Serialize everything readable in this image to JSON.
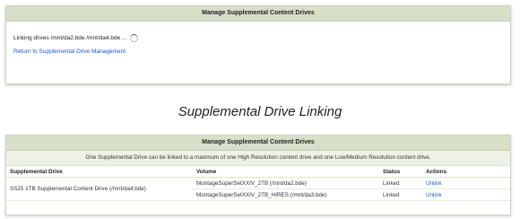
{
  "top_panel": {
    "header": "Manage Supplemental Content Drives",
    "status_text": "Linking drives /mnt/da2.bde /mnt/da4.bde ...",
    "return_link": "Return to Supplemental Drive Management",
    "spinner_icon": "spinner-icon"
  },
  "caption": "Supplemental Drive Linking",
  "bottom_panel": {
    "header": "Manage Supplemental Content Drives",
    "note": "One Supplemental Drive can be linked to a maximum of one High Resolution content drive and one Low/Medium Resolution content drive.",
    "columns": {
      "drive": "Supplemental Drive",
      "volume": "Volume",
      "status": "Status",
      "actions": "Actions"
    },
    "drive_name": "SS25 1TB Supplemental Content Drive (/mnt/da4.bde)",
    "rows": [
      {
        "volume": "MontageSuperSetXXIV_2TB (/mnt/da2.bde)",
        "status": "Linked",
        "action": "Unlink"
      },
      {
        "volume": "MontageSuperSetXXIV_2TB_HIRES (/mnt/da3.bde)",
        "status": "Linked",
        "action": "Unlink"
      }
    ]
  }
}
